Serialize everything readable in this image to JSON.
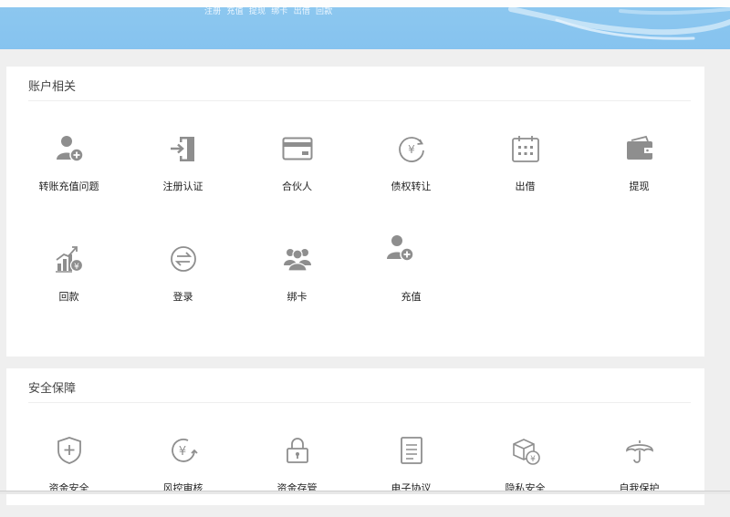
{
  "banner": {
    "links": [
      "注册",
      "充值",
      "提现",
      "绑卡",
      "出借",
      "回款"
    ]
  },
  "account": {
    "title": "账户相关",
    "items": [
      {
        "label": "转账充值问题",
        "icon": "user-add-icon"
      },
      {
        "label": "注册认证",
        "icon": "sign-in-door-icon"
      },
      {
        "label": "合伙人",
        "icon": "bank-card-icon"
      },
      {
        "label": "债权转让",
        "icon": "yuan-cycle-icon"
      },
      {
        "label": "出借",
        "icon": "calendar-icon"
      },
      {
        "label": "提现",
        "icon": "wallet-icon"
      },
      {
        "label": "回款",
        "icon": "growth-chart-yuan-icon"
      },
      {
        "label": "登录",
        "icon": "exchange-arrows-icon"
      },
      {
        "label": "绑卡",
        "icon": "user-group-icon"
      },
      {
        "label": "充值",
        "icon": "user-add-icon"
      }
    ]
  },
  "security": {
    "title": "安全保障",
    "items": [
      {
        "label": "资金安全",
        "icon": "shield-plus-icon"
      },
      {
        "label": "风控审核",
        "icon": "yuan-refresh-icon"
      },
      {
        "label": "资金存管",
        "icon": "padlock-icon"
      },
      {
        "label": "电子协议",
        "icon": "document-icon"
      },
      {
        "label": "隐私安全",
        "icon": "box-yuan-icon"
      },
      {
        "label": "自我保护",
        "icon": "umbrella-icon"
      }
    ]
  },
  "colors": {
    "banner": "#8cc7ef",
    "icon": "#8e8e8e",
    "background": "#efefef"
  }
}
